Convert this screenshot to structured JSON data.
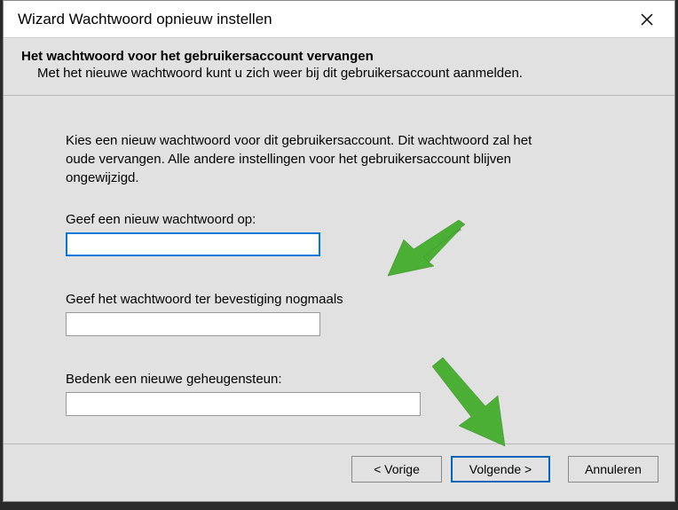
{
  "titlebar": {
    "title": "Wizard Wachtwoord opnieuw instellen"
  },
  "header": {
    "title": "Het wachtwoord voor het gebruikersaccount vervangen",
    "subtitle": "Met het nieuwe wachtwoord kunt u zich weer bij dit gebruikersaccount aanmelden."
  },
  "content": {
    "instruction": "Kies een nieuw wachtwoord voor dit gebruikersaccount. Dit wachtwoord zal het oude vervangen. Alle andere instellingen voor het gebruikersaccount blijven ongewijzigd.",
    "field1_label": "Geef een nieuw wachtwoord op:",
    "field1_value": "",
    "field2_label": "Geef het wachtwoord ter bevestiging nogmaals",
    "field2_value": "",
    "field3_label": "Bedenk een nieuwe geheugensteun:",
    "field3_value": ""
  },
  "buttons": {
    "back": "< Vorige",
    "next": "Volgende >",
    "cancel": "Annuleren"
  },
  "colors": {
    "accent": "#0078d7",
    "arrow": "#4caf35"
  }
}
